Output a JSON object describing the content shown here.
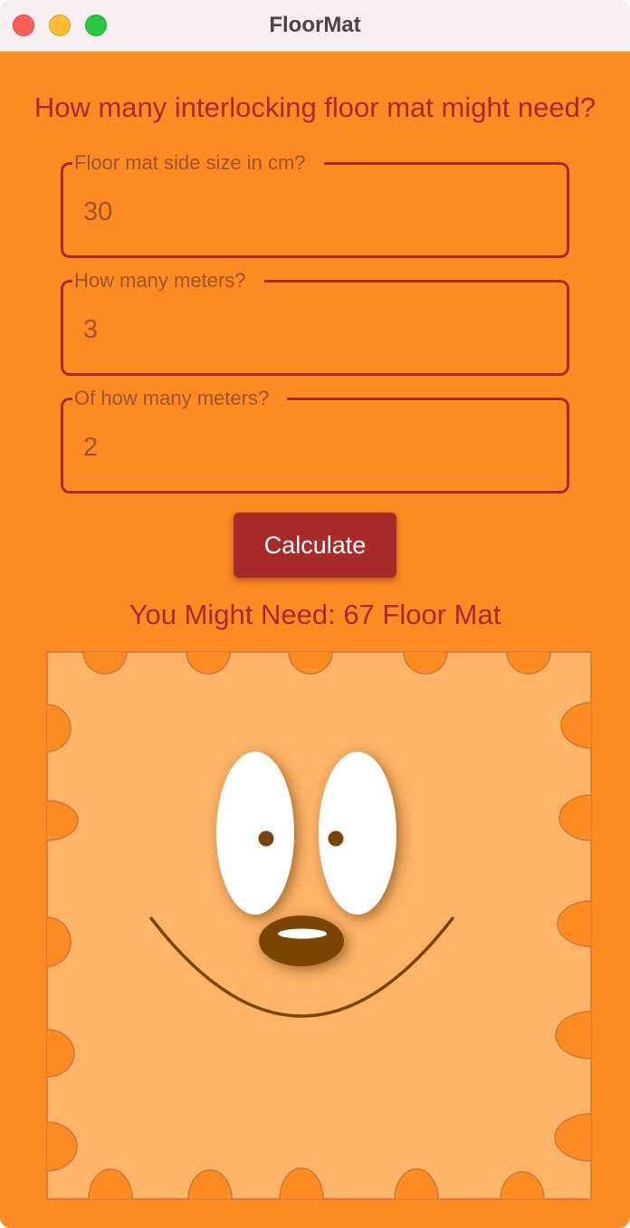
{
  "window": {
    "title": "FloorMat",
    "controls": [
      "close",
      "minimize",
      "maximize"
    ]
  },
  "form": {
    "question": "How many interlocking floor mat might need?",
    "fields": [
      {
        "label": "Floor mat side size in cm?",
        "value": "30"
      },
      {
        "label": "How many meters?",
        "value": "3"
      },
      {
        "label": "Of how many meters?",
        "value": "2"
      }
    ],
    "calculate_label": "Calculate"
  },
  "result": {
    "text": "You Might Need: 67 Floor Mat"
  },
  "colors": {
    "background": "#FD8B24",
    "accent": "#A82B2B",
    "mat": "#FDB466",
    "mat_border": "#C87A3A",
    "face_brown": "#7A4406"
  }
}
